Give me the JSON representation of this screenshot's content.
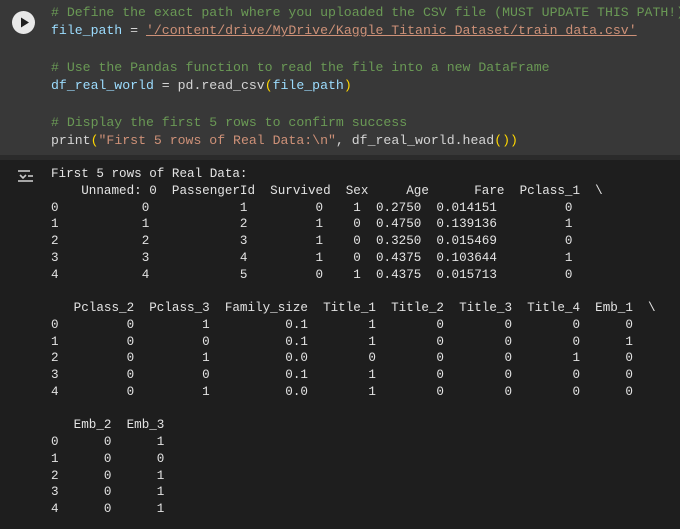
{
  "code_cell": {
    "comment1": "# Define the exact path where you uploaded the CSV file (MUST UPDATE THIS PATH!)",
    "line2_var": "file_path",
    "line2_eq": " = ",
    "line2_str": "'/content/drive/MyDrive/Kaggle_Titanic_Dataset/train_data.csv'",
    "comment2": "# Use the Pandas function to read the file into a new DataFrame",
    "line4_var": "df_real_world",
    "line4_mid": " = pd.read_csv",
    "line4_open": "(",
    "line4_arg": "file_path",
    "line4_close": ")",
    "comment3": "# Display the first 5 rows to confirm success",
    "line6_fn": "print",
    "line6_open": "(",
    "line6_str": "\"First 5 rows of Real Data:\\n\"",
    "line6_mid": ", df_real_world.head",
    "line6_inner": "()",
    "line6_close": ")"
  },
  "output": {
    "heading": "First 5 rows of Real Data:",
    "lines": [
      "    Unnamed: 0  PassengerId  Survived  Sex     Age      Fare  Pclass_1  \\",
      "0           0            1         0    1  0.2750  0.014151         0",
      "1           1            2         1    0  0.4750  0.139136         1",
      "2           2            3         1    0  0.3250  0.015469         0",
      "3           3            4         1    0  0.4375  0.103644         1",
      "4           4            5         0    1  0.4375  0.015713         0",
      "",
      "   Pclass_2  Pclass_3  Family_size  Title_1  Title_2  Title_3  Title_4  Emb_1  \\",
      "0         0         1          0.1        1        0        0        0      0",
      "1         0         0          0.1        1        0        0        0      1",
      "2         0         1          0.0        0        0        0        1      0",
      "3         0         0          0.1        1        0        0        0      0",
      "4         0         1          0.0        1        0        0        0      0",
      "",
      "   Emb_2  Emb_3",
      "0      0      1",
      "1      0      0",
      "2      0      1",
      "3      0      1",
      "4      0      1"
    ]
  },
  "colors": {
    "comment": "#6a9955",
    "string": "#ce9178",
    "bracket": "#ffd700",
    "cell_bg": "#383838",
    "output_bg": "#1e1e1e"
  },
  "icons": {
    "run": "play-icon",
    "output": "output-collapse-icon"
  }
}
